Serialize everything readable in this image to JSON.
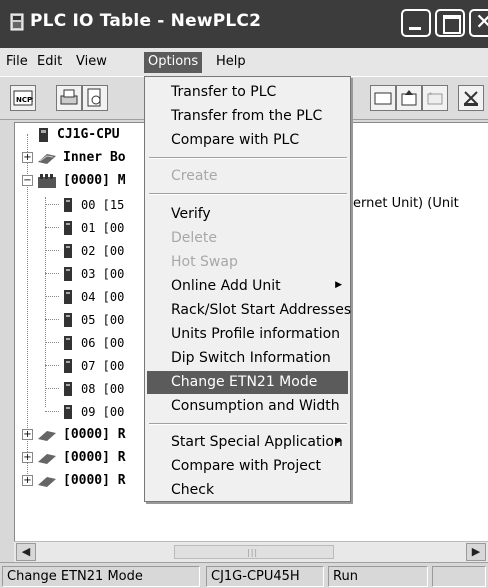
{
  "window": {
    "title": "PLC IO Table - NewPLC2"
  },
  "menubar": {
    "items": [
      "File",
      "Edit",
      "View",
      "Options",
      "Help"
    ]
  },
  "tree": {
    "root": "CJ1G-CPU",
    "inner_board": "Inner Bo",
    "rack0": "[0000] M",
    "slots": [
      "00 [15",
      "01 [00",
      "02 [00",
      "03 [00",
      "04 [00",
      "05 [00",
      "06 [00",
      "07 [00",
      "08 [00",
      "09 [00"
    ],
    "racks": [
      "[0000] R",
      "[0000] R",
      "[0000] R"
    ],
    "slot0_suffix": "ernet Unit) (Unit"
  },
  "options_menu": {
    "items": [
      {
        "label": "Transfer to PLC",
        "enabled": true
      },
      {
        "label": "Transfer from the PLC",
        "enabled": true
      },
      {
        "label": "Compare with PLC",
        "enabled": true
      },
      {
        "label": "Create",
        "enabled": false
      },
      {
        "label": "Verify",
        "enabled": true
      },
      {
        "label": "Delete",
        "enabled": false
      },
      {
        "label": "Hot Swap",
        "enabled": false
      },
      {
        "label": "Online Add Unit",
        "enabled": true,
        "submenu": true
      },
      {
        "label": "Rack/Slot Start Addresses",
        "enabled": true
      },
      {
        "label": "Units Profile information",
        "enabled": true
      },
      {
        "label": "Dip Switch Information",
        "enabled": true
      },
      {
        "label": "Change ETN21 Mode",
        "enabled": true,
        "highlighted": true
      },
      {
        "label": "Consumption and Width",
        "enabled": true
      },
      {
        "label": "Start Special Application",
        "enabled": true,
        "submenu": true
      },
      {
        "label": "Compare with Project",
        "enabled": true
      },
      {
        "label": "Check",
        "enabled": true
      }
    ]
  },
  "statusbar": {
    "message": "Change ETN21 Mode",
    "cpu": "CJ1G-CPU45H",
    "mode": "Run"
  },
  "colors": {
    "titlebar": "#3c3c3c",
    "highlight": "#5b5b5b"
  }
}
